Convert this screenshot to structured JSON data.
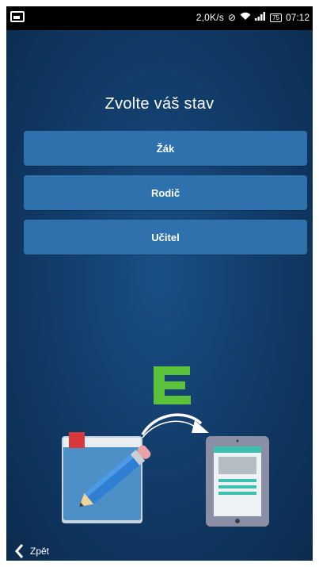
{
  "status_bar": {
    "speed": "2,0K/s",
    "battery": "75",
    "time": "07:12"
  },
  "page": {
    "title": "Zvolte váš stav"
  },
  "options": [
    {
      "label": "Žák"
    },
    {
      "label": "Rodič"
    },
    {
      "label": "Učitel"
    }
  ],
  "illustration": {
    "logo_letter": "E",
    "logo_color": "#5cc23b"
  },
  "navigation": {
    "back_label": "Zpět"
  },
  "colors": {
    "button": "#2f71ad",
    "background": "#123d6b"
  }
}
